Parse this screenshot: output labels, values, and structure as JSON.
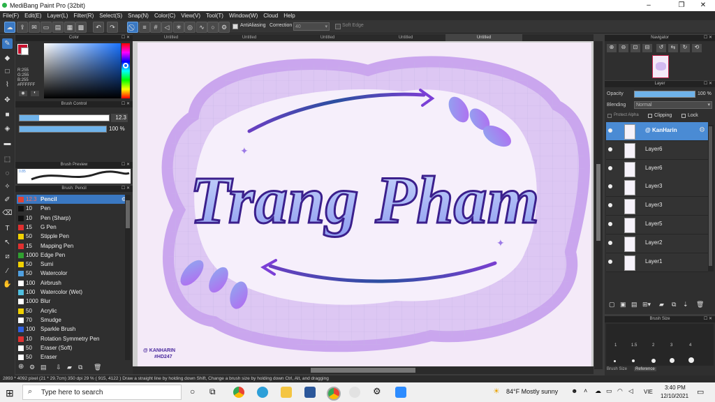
{
  "window": {
    "title": "MediBang Paint Pro (32bit)"
  },
  "menu": [
    "File(F)",
    "Edit(E)",
    "Layer(L)",
    "Filter(R)",
    "Select(S)",
    "Snap(N)",
    "Color(C)",
    "View(V)",
    "Tool(T)",
    "Window(W)",
    "Cloud",
    "Help"
  ],
  "toolbar": {
    "antialias_label": "AntiAliasing",
    "correction_label": "Correction",
    "correction_value": "40",
    "soft_edge_label": "Soft Edge"
  },
  "tabs": [
    "Untitled",
    "Untitled",
    "Untitled",
    "Untitled",
    "Untitled"
  ],
  "color_panel": {
    "title": "Color",
    "r": "R:255",
    "g": "G:255",
    "b": "B:255",
    "hex": "#FFFFFF"
  },
  "brush_control": {
    "title": "Brush Control",
    "size": "12.3",
    "opacity": "100 %"
  },
  "brush_preview": {
    "title": "Brush Preview",
    "size_label": "0.85"
  },
  "brush_list": {
    "title": "Brush: Pencil",
    "items": [
      {
        "size": "12.3",
        "name": "Pencil",
        "color": "#e34234"
      },
      {
        "size": "10",
        "name": "Pen",
        "color": "#111111"
      },
      {
        "size": "10",
        "name": "Pen (Sharp)",
        "color": "#111111"
      },
      {
        "size": "15",
        "name": "G Pen",
        "color": "#e03030"
      },
      {
        "size": "50",
        "name": "Stipple Pen",
        "color": "#f0d000"
      },
      {
        "size": "15",
        "name": "Mapping Pen",
        "color": "#e03030"
      },
      {
        "size": "1000",
        "name": "Edge Pen",
        "color": "#30a030"
      },
      {
        "size": "50",
        "name": "Sumi",
        "color": "#f0d000"
      },
      {
        "size": "50",
        "name": "Watercolor",
        "color": "#50a0e0"
      },
      {
        "size": "100",
        "name": "Airbrush",
        "color": "#ffffff"
      },
      {
        "size": "100",
        "name": "Watercolor (Wet)",
        "color": "#50c0e0"
      },
      {
        "size": "1000",
        "name": "Blur",
        "color": "#ffffff"
      },
      {
        "size": "50",
        "name": "Acrylic",
        "color": "#f0d000"
      },
      {
        "size": "70",
        "name": "Smudge",
        "color": "#ffffff"
      },
      {
        "size": "100",
        "name": "Sparkle Brush",
        "color": "#3060e0"
      },
      {
        "size": "10",
        "name": "Rotation Symmetry Pen",
        "color": "#e03030"
      },
      {
        "size": "50",
        "name": "Eraser (Soft)",
        "color": "#ffffff"
      },
      {
        "size": "50",
        "name": "Eraser",
        "color": "#ffffff"
      }
    ]
  },
  "artwork": {
    "main_text": "Trang Pham",
    "signature_1": "@ KANHARIN",
    "signature_2": "#HD247"
  },
  "navigator": {
    "title": "Navigator"
  },
  "layer_panel": {
    "title": "Layer",
    "opacity_label": "Opacity",
    "opacity_value": "100 %",
    "blending_label": "Blending",
    "blending_value": "Normal",
    "protect_alpha": "Protect Alpha",
    "clipping": "Clipping",
    "lock": "Lock",
    "layers": [
      "@ KanHarin",
      "Layer6",
      "Layer6",
      "Layer3",
      "Layer3",
      "Layer5",
      "Layer2",
      "Layer1"
    ]
  },
  "brush_size_panel": {
    "title": "Brush Size",
    "sizes": [
      "1",
      "1.5",
      "2",
      "3",
      "4"
    ],
    "tabs": [
      "Brush Size",
      "Reference"
    ]
  },
  "status": "2893 * 4092 pixel  (21 * 29.7cm)  350 dpi  29 %  ( 915, 4122 )  Draw a straight line by holding down Shift, Change a brush size by holding down Ctrl, Alt, and dragging",
  "taskbar": {
    "search_placeholder": "Type here to search",
    "weather": "84°F  Mostly sunny",
    "lang": "VIE",
    "time": "3:40 PM",
    "date": "12/10/2021"
  }
}
